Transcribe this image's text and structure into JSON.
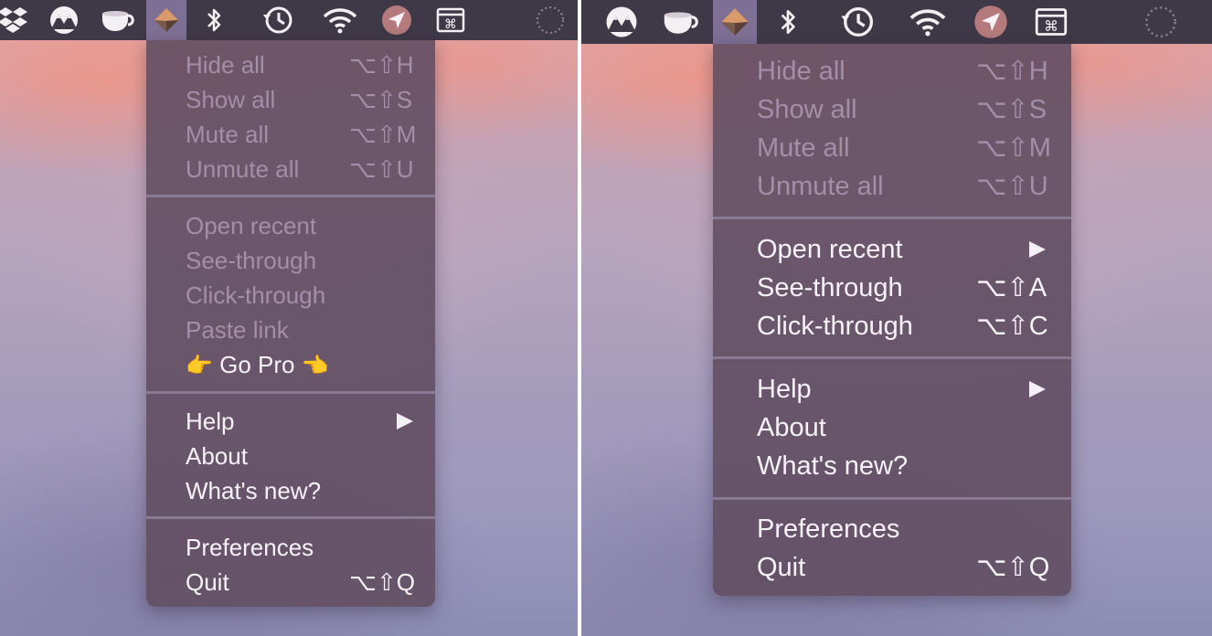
{
  "left_panel": {
    "menu": {
      "group1": [
        {
          "label": "Hide all",
          "shortcut": "⌥⇧H"
        },
        {
          "label": "Show all",
          "shortcut": "⌥⇧S"
        },
        {
          "label": "Mute all",
          "shortcut": "⌥⇧M"
        },
        {
          "label": "Unmute all",
          "shortcut": "⌥⇧U"
        }
      ],
      "group2": [
        {
          "label": "Open recent"
        },
        {
          "label": "See-through"
        },
        {
          "label": "Click-through"
        },
        {
          "label": "Paste link"
        }
      ],
      "go_pro": {
        "label": "Go Pro",
        "hand_left": "👉",
        "hand_right": "👈"
      },
      "group3": [
        {
          "label": "Help"
        },
        {
          "label": "About"
        },
        {
          "label": "What's new?"
        }
      ],
      "group4": [
        {
          "label": "Preferences"
        },
        {
          "label": "Quit",
          "shortcut": "⌥⇧Q"
        }
      ]
    }
  },
  "right_panel": {
    "menu": {
      "group1": [
        {
          "label": "Hide all",
          "shortcut": "⌥⇧H"
        },
        {
          "label": "Show all",
          "shortcut": "⌥⇧S"
        },
        {
          "label": "Mute all",
          "shortcut": "⌥⇧M"
        },
        {
          "label": "Unmute all",
          "shortcut": "⌥⇧U"
        }
      ],
      "group2": [
        {
          "label": "Open recent"
        },
        {
          "label": "See-through",
          "shortcut": "⌥⇧A"
        },
        {
          "label": "Click-through",
          "shortcut": "⌥⇧C"
        }
      ],
      "group3": [
        {
          "label": "Help"
        },
        {
          "label": "About"
        },
        {
          "label": "What's new?"
        }
      ],
      "group4": [
        {
          "label": "Preferences"
        },
        {
          "label": "Quit",
          "shortcut": "⌥⇧Q"
        }
      ]
    }
  },
  "colors": {
    "menubar": "#3f3847",
    "menu_background": "#624e62",
    "enabled_text": "#f7f2f7",
    "disabled_text": "#a48ea8",
    "active_icon_highlight": "#7e6f95"
  },
  "icons": [
    "dropbox-icon",
    "mountain-m-icon",
    "coffee-cup-icon",
    "app-diamond-icon",
    "bluetooth-icon",
    "time-machine-icon",
    "wifi-icon",
    "location-arrow-icon",
    "command-window-icon",
    "progress-spinner-icon"
  ]
}
